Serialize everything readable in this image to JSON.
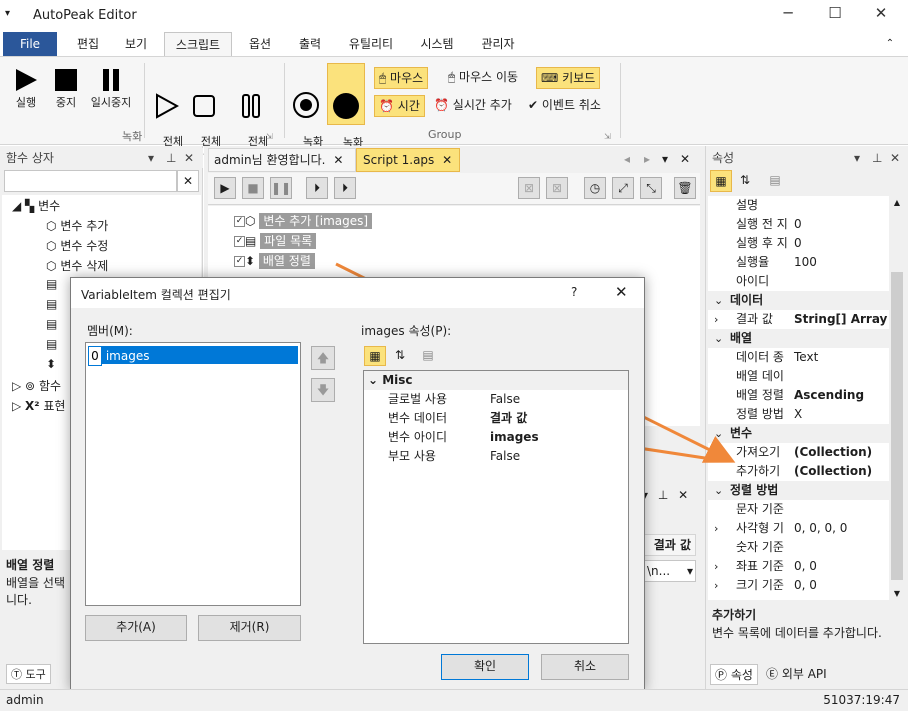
{
  "title": "AutoPeak Editor",
  "menu": {
    "file": "File",
    "edit": "편집",
    "view": "보기",
    "script": "스크립트",
    "options": "옵션",
    "output": "출력",
    "utility": "유틸리티",
    "system": "시스템",
    "admin": "관리자"
  },
  "ribbon": {
    "record_group": "녹화",
    "group_group": "Group",
    "run": "실행",
    "stop": "중지",
    "pause": "일시중지",
    "all_run": "전체\n실행",
    "all_stop": "전체\n중지",
    "all_pause": "전체\n일시중지",
    "rec_start": "녹화\n시작",
    "rec_stop": "녹화\n중지",
    "mouse": "마우스",
    "mouse_move": "마우스 이동",
    "keyboard": "키보드",
    "time": "시간",
    "realtime_add": "실시간 추가",
    "event_cancel": "이벤트 취소"
  },
  "left_panel": {
    "title": "함수 상자",
    "tree": {
      "variable": "변수",
      "var_add": "변수 추가",
      "var_edit": "변수 수정",
      "var_delete": "변수 삭제",
      "func": "함수",
      "expr": "표현"
    },
    "desc_title": "배열 정렬",
    "desc_text": "배열을 선택\n니다.",
    "tab_tools": "도구"
  },
  "doc_tabs": {
    "welcome": "admin님 환영합니다.",
    "script": "Script 1.aps"
  },
  "script_items": [
    {
      "label": "변수 추가 [images]"
    },
    {
      "label": "파일 목록"
    },
    {
      "label": "배열 정렬"
    }
  ],
  "right_panel": {
    "title": "속성",
    "rows": [
      {
        "name": "설명",
        "value": "",
        "kind": "row"
      },
      {
        "name": "실행 전 지",
        "value": "0",
        "kind": "row"
      },
      {
        "name": "실행 후 지",
        "value": "0",
        "kind": "row"
      },
      {
        "name": "실행율",
        "value": "100",
        "kind": "row"
      },
      {
        "name": "아이디",
        "value": "",
        "kind": "row"
      },
      {
        "name": "데이터",
        "value": "",
        "kind": "cat"
      },
      {
        "name": "결과 값",
        "value": "String[] Array",
        "kind": "bold",
        "exp": ">"
      },
      {
        "name": "배열",
        "value": "",
        "kind": "cat"
      },
      {
        "name": "데이터 종",
        "value": "Text",
        "kind": "row"
      },
      {
        "name": "배열 데이",
        "value": "",
        "kind": "row"
      },
      {
        "name": "배열 정렬",
        "value": "Ascending",
        "kind": "bold"
      },
      {
        "name": "정렬 방법",
        "value": "X",
        "kind": "row"
      },
      {
        "name": "변수",
        "value": "",
        "kind": "cat"
      },
      {
        "name": "가져오기",
        "value": "(Collection)",
        "kind": "bold"
      },
      {
        "name": "추가하기",
        "value": "(Collection)",
        "kind": "bold"
      },
      {
        "name": "정렬 방법",
        "value": "",
        "kind": "cat"
      },
      {
        "name": "문자 기준",
        "value": "",
        "kind": "row"
      },
      {
        "name": "사각형 기",
        "value": "0, 0, 0, 0",
        "kind": "row",
        "exp": ">"
      },
      {
        "name": "숫자 기준",
        "value": "",
        "kind": "row"
      },
      {
        "name": "좌표 기준",
        "value": "0, 0",
        "kind": "row",
        "exp": ">"
      },
      {
        "name": "크기 기준",
        "value": "0, 0",
        "kind": "row",
        "exp": ">"
      }
    ],
    "desc_title": "추가하기",
    "desc_text": "변수 목록에 데이터를 추가합니다.",
    "tab_props": "속성",
    "tab_api": "외부 API"
  },
  "middle_bottom": {
    "col": "결과 값",
    "cell": "\\n..."
  },
  "dialog": {
    "title": "VariableItem 컬렉션 편집기",
    "help": "?",
    "members_label": "멤버(M):",
    "member_index": "0",
    "member_name": "images",
    "props_label": "images 속성(P):",
    "category": "Misc",
    "props": [
      {
        "name": "글로벌 사용",
        "value": "False",
        "bold": false
      },
      {
        "name": "변수 데이터",
        "value": "결과 값",
        "bold": true
      },
      {
        "name": "변수 아이디",
        "value": "images",
        "bold": true
      },
      {
        "name": "부모 사용",
        "value": "False",
        "bold": false
      }
    ],
    "add": "추가(A)",
    "remove": "제거(R)",
    "ok": "확인",
    "cancel": "취소"
  },
  "status": {
    "user": "admin",
    "time": "51037:19:47"
  },
  "colors": {
    "accent": "#2b579a",
    "highlight": "#fbe27c",
    "arrow": "#f0883a"
  }
}
